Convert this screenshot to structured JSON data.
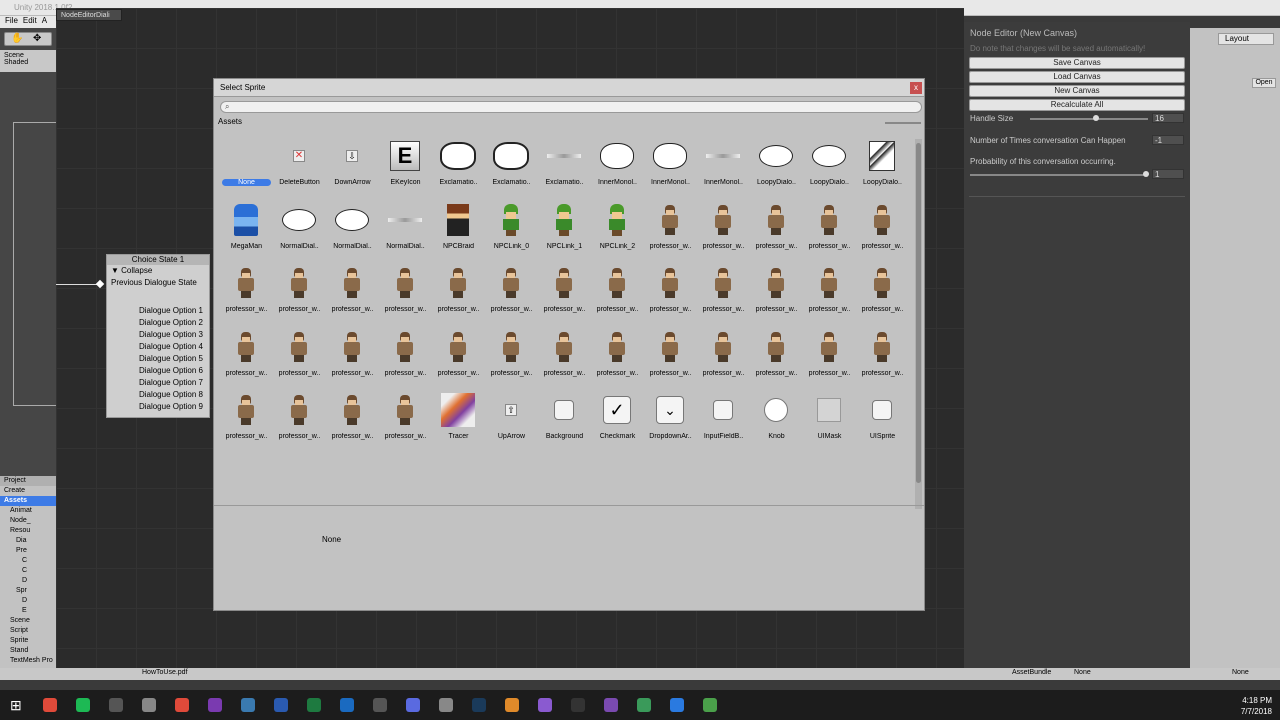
{
  "window": {
    "title": "Unity 2018.1.0f2",
    "graph_tab": "NodeEditorDiali",
    "menu": [
      "File",
      "Edit",
      "A"
    ]
  },
  "scene_tab": {
    "label": "Scene",
    "mode": "Shaded"
  },
  "project_panel": {
    "tab": "Project",
    "create": "Create",
    "tree": [
      "Assets",
      "Animat",
      "Node_",
      "Resou",
      "Dia",
      "Pre",
      "C",
      "C",
      "D",
      "Spr",
      "D",
      "E",
      "Scene",
      "Script",
      "Sprite",
      "Stand",
      "TextMesh Pro"
    ]
  },
  "node": {
    "title": "Choice State 1",
    "collapse": "Collapse",
    "previous": "Previous Dialogue State",
    "options": [
      "Dialogue Option 1",
      "Dialogue Option 2",
      "Dialogue Option 3",
      "Dialogue Option 4",
      "Dialogue Option 5",
      "Dialogue Option 6",
      "Dialogue Option 7",
      "Dialogue Option 8",
      "Dialogue Option 9"
    ]
  },
  "node_editor": {
    "title": "Node Editor (New Canvas)",
    "note": "Do note that changes will be saved automatically!",
    "buttons": [
      "Save Canvas",
      "Load Canvas",
      "New Canvas",
      "Recalculate All"
    ],
    "handle_size_label": "Handle Size",
    "handle_size_value": "16",
    "times_label": "Number of Times conversation Can Happen",
    "times_value": "-1",
    "prob_label": "Probability of this conversation occurring.",
    "prob_value": "1"
  },
  "inspector": {
    "layout": "Layout",
    "open": "Open"
  },
  "status": {
    "file": "HowToUse.pdf",
    "asset_bundle": "AssetBundle",
    "none1": "None",
    "none2": "None"
  },
  "dialog": {
    "title": "Select Sprite",
    "close": "x",
    "search_placeholder": "",
    "tab": "Assets",
    "selected_label": "None",
    "sprites": [
      {
        "label": "None",
        "kind": "none"
      },
      {
        "label": "DeleteButton",
        "kind": "delete"
      },
      {
        "label": "DownArrow",
        "kind": "downarrow"
      },
      {
        "label": "EKeyIcon",
        "kind": "ekey"
      },
      {
        "label": "Exclamatio..",
        "kind": "spiky"
      },
      {
        "label": "Exclamatio..",
        "kind": "spiky"
      },
      {
        "label": "Exclamatio..",
        "kind": "line"
      },
      {
        "label": "InnerMonol..",
        "kind": "cloud"
      },
      {
        "label": "InnerMonol..",
        "kind": "cloud"
      },
      {
        "label": "InnerMonol..",
        "kind": "line"
      },
      {
        "label": "LoopyDialo..",
        "kind": "bubble"
      },
      {
        "label": "LoopyDialo..",
        "kind": "bubble"
      },
      {
        "label": "LoopyDialo..",
        "kind": "zap"
      },
      {
        "label": "MegaMan",
        "kind": "megaman"
      },
      {
        "label": "NormalDial..",
        "kind": "bubble"
      },
      {
        "label": "NormalDial..",
        "kind": "bubble"
      },
      {
        "label": "NormalDial..",
        "kind": "line"
      },
      {
        "label": "NPCBraid",
        "kind": "braid"
      },
      {
        "label": "NPCLink_0",
        "kind": "link"
      },
      {
        "label": "NPCLink_1",
        "kind": "link"
      },
      {
        "label": "NPCLink_2",
        "kind": "link"
      },
      {
        "label": "professor_w..",
        "kind": "prof"
      },
      {
        "label": "professor_w..",
        "kind": "prof"
      },
      {
        "label": "professor_w..",
        "kind": "prof"
      },
      {
        "label": "professor_w..",
        "kind": "prof"
      },
      {
        "label": "professor_w..",
        "kind": "prof"
      },
      {
        "label": "professor_w..",
        "kind": "prof"
      },
      {
        "label": "professor_w..",
        "kind": "prof"
      },
      {
        "label": "professor_w..",
        "kind": "prof"
      },
      {
        "label": "professor_w..",
        "kind": "prof"
      },
      {
        "label": "professor_w..",
        "kind": "prof"
      },
      {
        "label": "professor_w..",
        "kind": "prof"
      },
      {
        "label": "professor_w..",
        "kind": "prof"
      },
      {
        "label": "professor_w..",
        "kind": "prof"
      },
      {
        "label": "professor_w..",
        "kind": "prof"
      },
      {
        "label": "professor_w..",
        "kind": "prof"
      },
      {
        "label": "professor_w..",
        "kind": "prof"
      },
      {
        "label": "professor_w..",
        "kind": "prof"
      },
      {
        "label": "professor_w..",
        "kind": "prof"
      },
      {
        "label": "professor_w..",
        "kind": "prof"
      },
      {
        "label": "professor_w..",
        "kind": "prof"
      },
      {
        "label": "professor_w..",
        "kind": "prof"
      },
      {
        "label": "professor_w..",
        "kind": "prof"
      },
      {
        "label": "professor_w..",
        "kind": "prof"
      },
      {
        "label": "professor_w..",
        "kind": "prof"
      },
      {
        "label": "professor_w..",
        "kind": "prof"
      },
      {
        "label": "professor_w..",
        "kind": "prof"
      },
      {
        "label": "professor_w..",
        "kind": "prof"
      },
      {
        "label": "professor_w..",
        "kind": "prof"
      },
      {
        "label": "professor_w..",
        "kind": "prof"
      },
      {
        "label": "professor_w..",
        "kind": "prof"
      },
      {
        "label": "professor_w..",
        "kind": "prof"
      },
      {
        "label": "professor_w..",
        "kind": "prof"
      },
      {
        "label": "professor_w..",
        "kind": "prof"
      },
      {
        "label": "professor_w..",
        "kind": "prof"
      },
      {
        "label": "professor_w..",
        "kind": "prof"
      },
      {
        "label": "Tracer",
        "kind": "tracer"
      },
      {
        "label": "UpArrow",
        "kind": "uparrow"
      },
      {
        "label": "Background",
        "kind": "uibox"
      },
      {
        "label": "Checkmark",
        "kind": "check"
      },
      {
        "label": "DropdownAr..",
        "kind": "dropdown"
      },
      {
        "label": "InputFieldB..",
        "kind": "uibox"
      },
      {
        "label": "Knob",
        "kind": "knob"
      },
      {
        "label": "UIMask",
        "kind": "mask"
      },
      {
        "label": "UISprite",
        "kind": "uibox"
      }
    ]
  },
  "taskbar": {
    "time": "4:18 PM",
    "date": "7/7/2018"
  }
}
